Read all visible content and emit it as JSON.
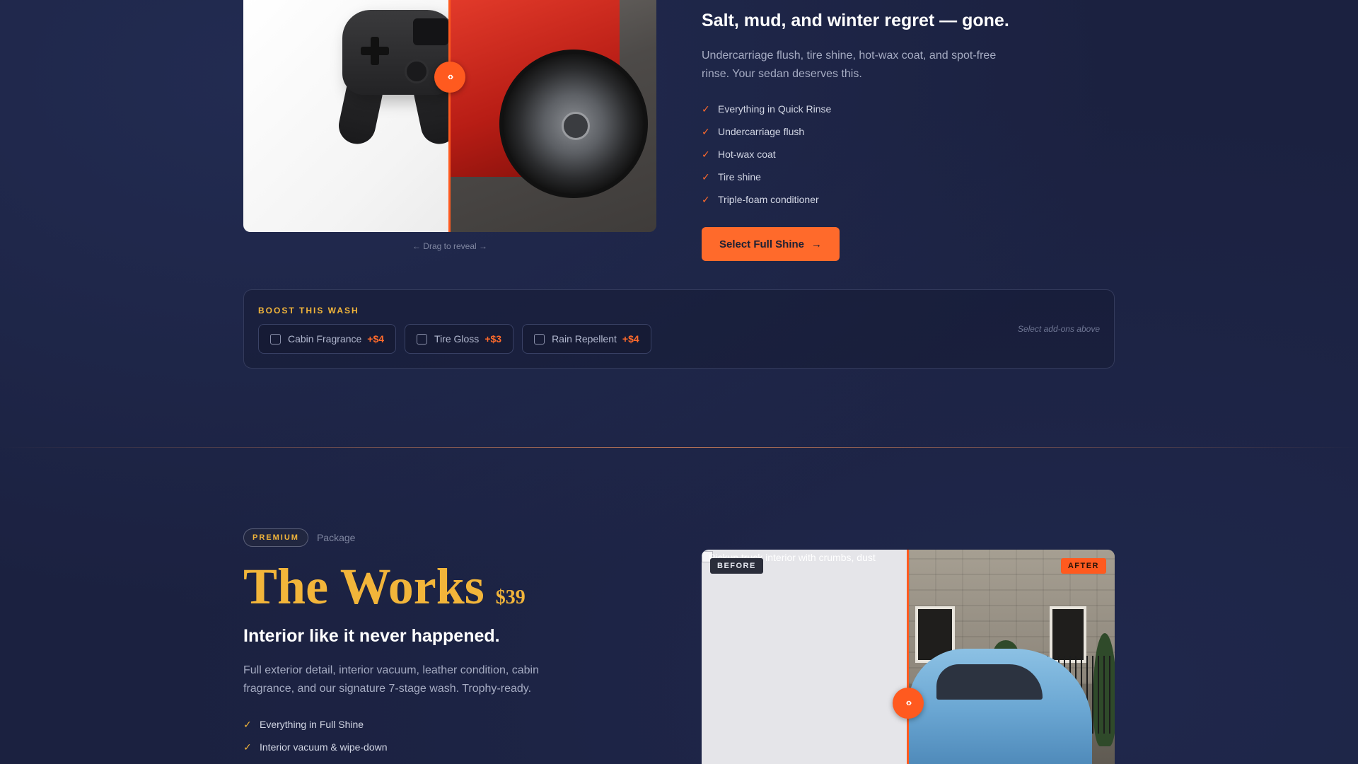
{
  "full_shine": {
    "headline": "Salt, mud, and winter regret — gone.",
    "description": "Undercarriage flush, tire shine, hot-wax coat, and spot-free rinse. Your sedan deserves this.",
    "features": [
      "Everything in Quick Rinse",
      "Undercarriage flush",
      "Hot-wax coat",
      "Tire shine",
      "Triple-foam conditioner"
    ],
    "check_glyph": "✓",
    "cta_label": "Select Full Shine",
    "cta_arrow": "→",
    "slider_hint": "← Drag to reveal →",
    "handle_glyph": "‹›"
  },
  "boost": {
    "title": "BOOST THIS WASH",
    "addons": [
      {
        "label": "Cabin Fragrance",
        "price": "+$4"
      },
      {
        "label": "Tire Gloss",
        "price": "+$3"
      },
      {
        "label": "Rain Repellent",
        "price": "+$4"
      }
    ],
    "hint": "Select add-ons above"
  },
  "the_works": {
    "tier": "PREMIUM",
    "tier_suffix": "Package",
    "name": "The Works",
    "price": "$39",
    "tagline": "Interior like it never happened.",
    "description": "Full exterior detail, interior vacuum, leather condition, cabin fragrance, and our signature 7-stage wash. Trophy-ready.",
    "features": [
      "Everything in Full Shine",
      "Interior vacuum & wipe-down"
    ],
    "before_alt_text": "Pickup truck interior with crumbs, dust",
    "before_tag": "BEFORE",
    "after_tag": "AFTER",
    "handle_glyph": "‹›"
  },
  "colors": {
    "accent_orange": "#ff6a2b",
    "accent_gold": "#f2b53a",
    "background": "#1b2140"
  },
  "icons": {
    "check": "checkmark-icon",
    "slider_handle": "chevrons-left-right-icon",
    "checkbox": "checkbox-unchecked-icon"
  }
}
